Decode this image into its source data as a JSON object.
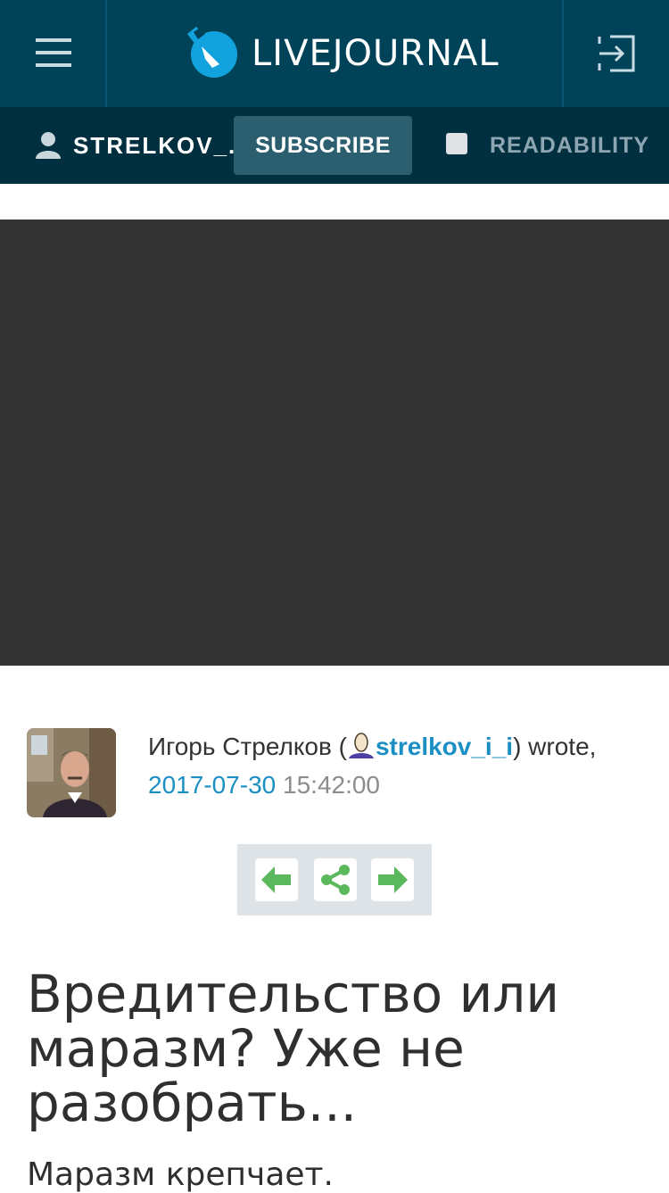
{
  "header": {
    "logo_text": "LIVEJOURNAL",
    "menu_icon": "hamburger-menu-icon",
    "login_icon": "login-icon"
  },
  "subbar": {
    "username": "STRELKOV_...",
    "subscribe_label": "SUBSCRIBE",
    "readability_label": "READABILITY"
  },
  "post": {
    "author_name": "Игорь Стрелков",
    "open_paren": "(",
    "lj_user": "strelkov_i_i",
    "wrote_suffix": ") wrote,",
    "date": "2017-07-30",
    "time": "15:42:00",
    "title": "Вредительство или маразм? Уже не разобрать...",
    "body_start": "Маразм крепчает."
  },
  "colors": {
    "header_bg": "#004359",
    "subbar_bg": "#002f40",
    "link": "#1b8fc4",
    "nav_arrow": "#5cb85c"
  }
}
